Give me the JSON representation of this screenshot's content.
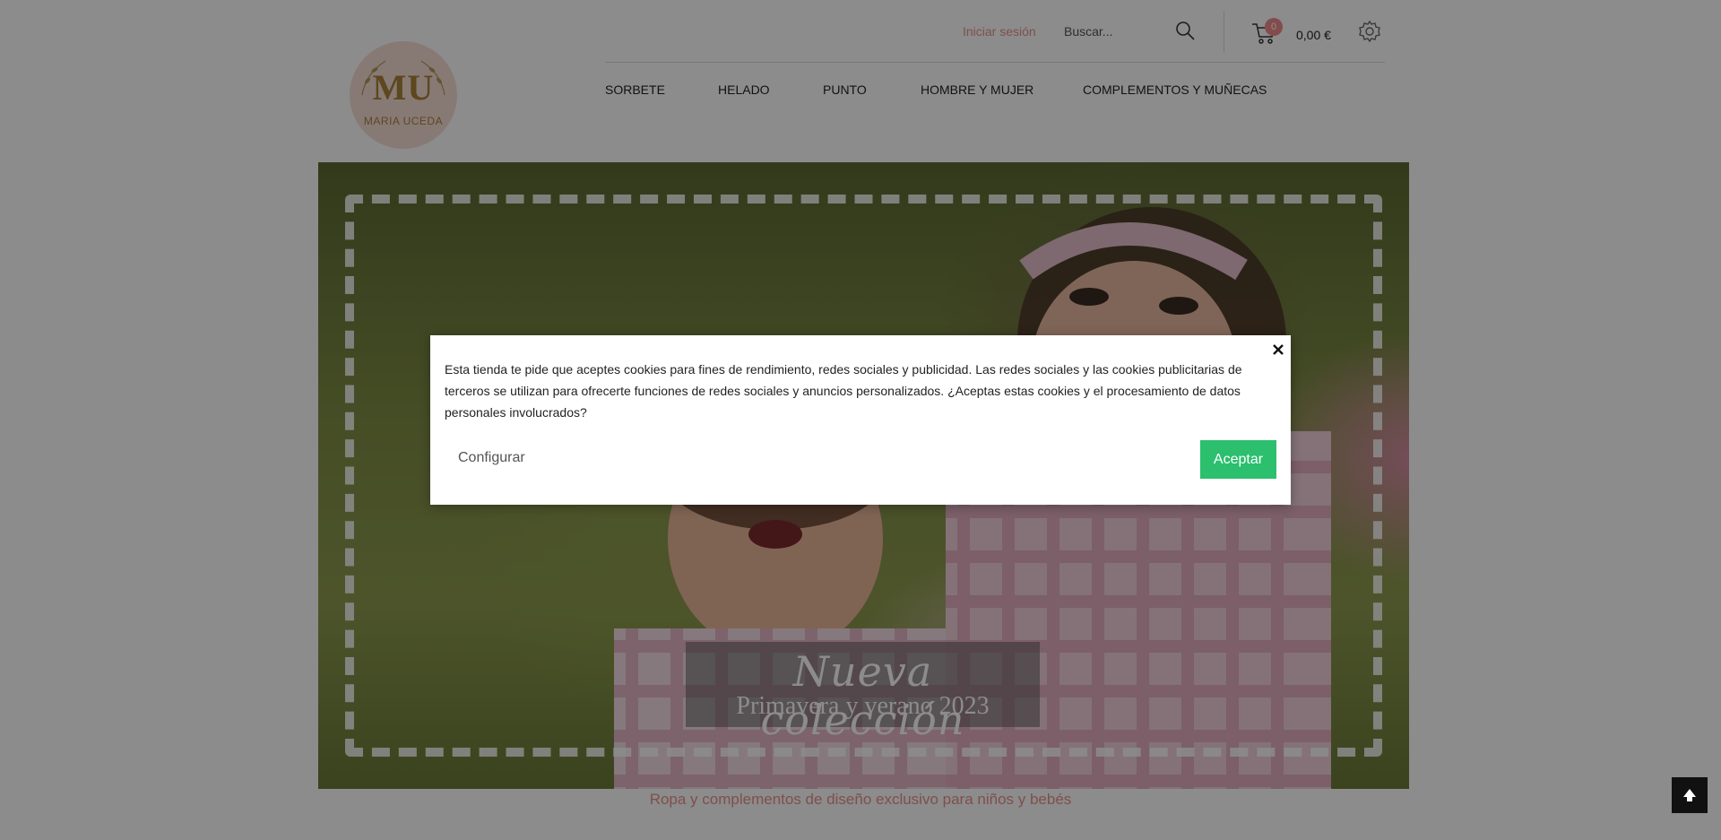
{
  "header": {
    "login_label": "Iniciar sesión",
    "search_placeholder": "Buscar...",
    "cart_count": "0",
    "cart_total": "0,00 €"
  },
  "logo": {
    "mark": "MU",
    "name": "MARIA UCEDA"
  },
  "nav": {
    "items": [
      "SORBETE",
      "HELADO",
      "PUNTO",
      "HOMBRE Y MUJER",
      "COMPLEMENTOS Y MUÑECAS"
    ]
  },
  "hero": {
    "title": "Nueva colección",
    "subtitle": "Primavera y verano 2023"
  },
  "tagline": "Ropa y complementos de diseño exclusivo para niños y bebés",
  "cookie_modal": {
    "text": "Esta tienda te pide que aceptes cookies para fines de rendimiento, redes sociales y publicidad. Las redes sociales y las cookies publicitarias de terceros se utilizan para ofrecerte funciones de redes sociales y anuncios personalizados. ¿Aceptas estas cookies y el procesamiento de datos personales involucrados?",
    "configure_label": "Configurar",
    "accept_label": "Aceptar"
  },
  "colors": {
    "accent_pink": "#e8908b",
    "accept_green": "#2bbf6e",
    "logo_gold": "#a98138"
  },
  "icons": {
    "search": "search-icon",
    "cart": "cart-icon",
    "settings": "gear-icon",
    "close": "close-icon",
    "scroll_top": "arrow-up-icon"
  }
}
